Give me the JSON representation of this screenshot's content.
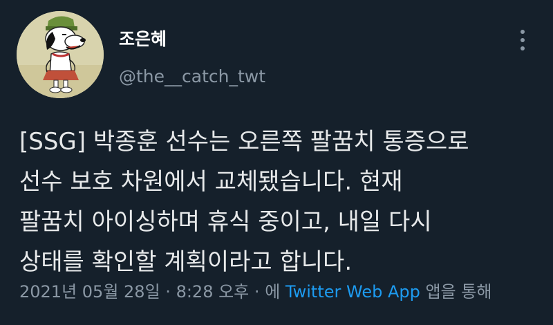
{
  "tweet": {
    "display_name": "조은혜",
    "handle": "@the__catch_twt",
    "text": "[SSG] 박종훈 선수는 오른쪽 팔꿈치 통증으로\n선수 보호 차원에서 교체됐습니다. 현재\n팔꿈치 아이싱하며 휴식 중이고, 내일 다시\n상태를 확인할 계획이라고 합니다.",
    "date": "2021년 05월 28일",
    "separator": "·",
    "time": "8:28 오후",
    "via_prefix": "에",
    "source": "Twitter Web App",
    "via_suffix": "앱을 통해"
  },
  "icons": {
    "more": "more-vertical-icon",
    "avatar": "snoopy-avatar"
  },
  "colors": {
    "background": "#15202b",
    "primary_text": "#e7e9ea",
    "secondary_text": "#8b98a5",
    "link": "#1d9bf0"
  }
}
